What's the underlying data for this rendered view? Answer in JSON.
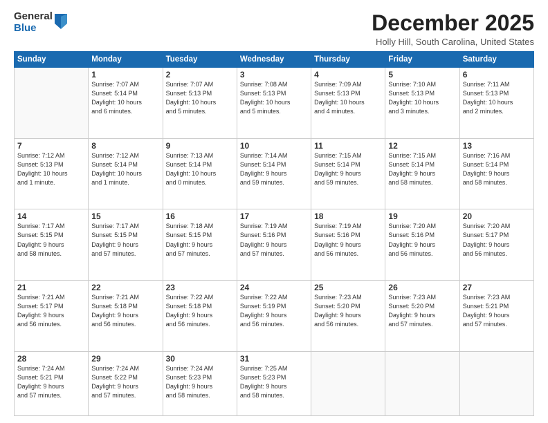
{
  "logo": {
    "general": "General",
    "blue": "Blue"
  },
  "title": "December 2025",
  "location": "Holly Hill, South Carolina, United States",
  "days_header": [
    "Sunday",
    "Monday",
    "Tuesday",
    "Wednesday",
    "Thursday",
    "Friday",
    "Saturday"
  ],
  "weeks": [
    [
      {
        "day": "",
        "info": ""
      },
      {
        "day": "1",
        "info": "Sunrise: 7:07 AM\nSunset: 5:14 PM\nDaylight: 10 hours\nand 6 minutes."
      },
      {
        "day": "2",
        "info": "Sunrise: 7:07 AM\nSunset: 5:13 PM\nDaylight: 10 hours\nand 5 minutes."
      },
      {
        "day": "3",
        "info": "Sunrise: 7:08 AM\nSunset: 5:13 PM\nDaylight: 10 hours\nand 5 minutes."
      },
      {
        "day": "4",
        "info": "Sunrise: 7:09 AM\nSunset: 5:13 PM\nDaylight: 10 hours\nand 4 minutes."
      },
      {
        "day": "5",
        "info": "Sunrise: 7:10 AM\nSunset: 5:13 PM\nDaylight: 10 hours\nand 3 minutes."
      },
      {
        "day": "6",
        "info": "Sunrise: 7:11 AM\nSunset: 5:13 PM\nDaylight: 10 hours\nand 2 minutes."
      }
    ],
    [
      {
        "day": "7",
        "info": "Sunrise: 7:12 AM\nSunset: 5:13 PM\nDaylight: 10 hours\nand 1 minute."
      },
      {
        "day": "8",
        "info": "Sunrise: 7:12 AM\nSunset: 5:14 PM\nDaylight: 10 hours\nand 1 minute."
      },
      {
        "day": "9",
        "info": "Sunrise: 7:13 AM\nSunset: 5:14 PM\nDaylight: 10 hours\nand 0 minutes."
      },
      {
        "day": "10",
        "info": "Sunrise: 7:14 AM\nSunset: 5:14 PM\nDaylight: 9 hours\nand 59 minutes."
      },
      {
        "day": "11",
        "info": "Sunrise: 7:15 AM\nSunset: 5:14 PM\nDaylight: 9 hours\nand 59 minutes."
      },
      {
        "day": "12",
        "info": "Sunrise: 7:15 AM\nSunset: 5:14 PM\nDaylight: 9 hours\nand 58 minutes."
      },
      {
        "day": "13",
        "info": "Sunrise: 7:16 AM\nSunset: 5:14 PM\nDaylight: 9 hours\nand 58 minutes."
      }
    ],
    [
      {
        "day": "14",
        "info": "Sunrise: 7:17 AM\nSunset: 5:15 PM\nDaylight: 9 hours\nand 58 minutes."
      },
      {
        "day": "15",
        "info": "Sunrise: 7:17 AM\nSunset: 5:15 PM\nDaylight: 9 hours\nand 57 minutes."
      },
      {
        "day": "16",
        "info": "Sunrise: 7:18 AM\nSunset: 5:15 PM\nDaylight: 9 hours\nand 57 minutes."
      },
      {
        "day": "17",
        "info": "Sunrise: 7:19 AM\nSunset: 5:16 PM\nDaylight: 9 hours\nand 57 minutes."
      },
      {
        "day": "18",
        "info": "Sunrise: 7:19 AM\nSunset: 5:16 PM\nDaylight: 9 hours\nand 56 minutes."
      },
      {
        "day": "19",
        "info": "Sunrise: 7:20 AM\nSunset: 5:16 PM\nDaylight: 9 hours\nand 56 minutes."
      },
      {
        "day": "20",
        "info": "Sunrise: 7:20 AM\nSunset: 5:17 PM\nDaylight: 9 hours\nand 56 minutes."
      }
    ],
    [
      {
        "day": "21",
        "info": "Sunrise: 7:21 AM\nSunset: 5:17 PM\nDaylight: 9 hours\nand 56 minutes."
      },
      {
        "day": "22",
        "info": "Sunrise: 7:21 AM\nSunset: 5:18 PM\nDaylight: 9 hours\nand 56 minutes."
      },
      {
        "day": "23",
        "info": "Sunrise: 7:22 AM\nSunset: 5:18 PM\nDaylight: 9 hours\nand 56 minutes."
      },
      {
        "day": "24",
        "info": "Sunrise: 7:22 AM\nSunset: 5:19 PM\nDaylight: 9 hours\nand 56 minutes."
      },
      {
        "day": "25",
        "info": "Sunrise: 7:23 AM\nSunset: 5:20 PM\nDaylight: 9 hours\nand 56 minutes."
      },
      {
        "day": "26",
        "info": "Sunrise: 7:23 AM\nSunset: 5:20 PM\nDaylight: 9 hours\nand 57 minutes."
      },
      {
        "day": "27",
        "info": "Sunrise: 7:23 AM\nSunset: 5:21 PM\nDaylight: 9 hours\nand 57 minutes."
      }
    ],
    [
      {
        "day": "28",
        "info": "Sunrise: 7:24 AM\nSunset: 5:21 PM\nDaylight: 9 hours\nand 57 minutes."
      },
      {
        "day": "29",
        "info": "Sunrise: 7:24 AM\nSunset: 5:22 PM\nDaylight: 9 hours\nand 57 minutes."
      },
      {
        "day": "30",
        "info": "Sunrise: 7:24 AM\nSunset: 5:23 PM\nDaylight: 9 hours\nand 58 minutes."
      },
      {
        "day": "31",
        "info": "Sunrise: 7:25 AM\nSunset: 5:23 PM\nDaylight: 9 hours\nand 58 minutes."
      },
      {
        "day": "",
        "info": ""
      },
      {
        "day": "",
        "info": ""
      },
      {
        "day": "",
        "info": ""
      }
    ]
  ]
}
